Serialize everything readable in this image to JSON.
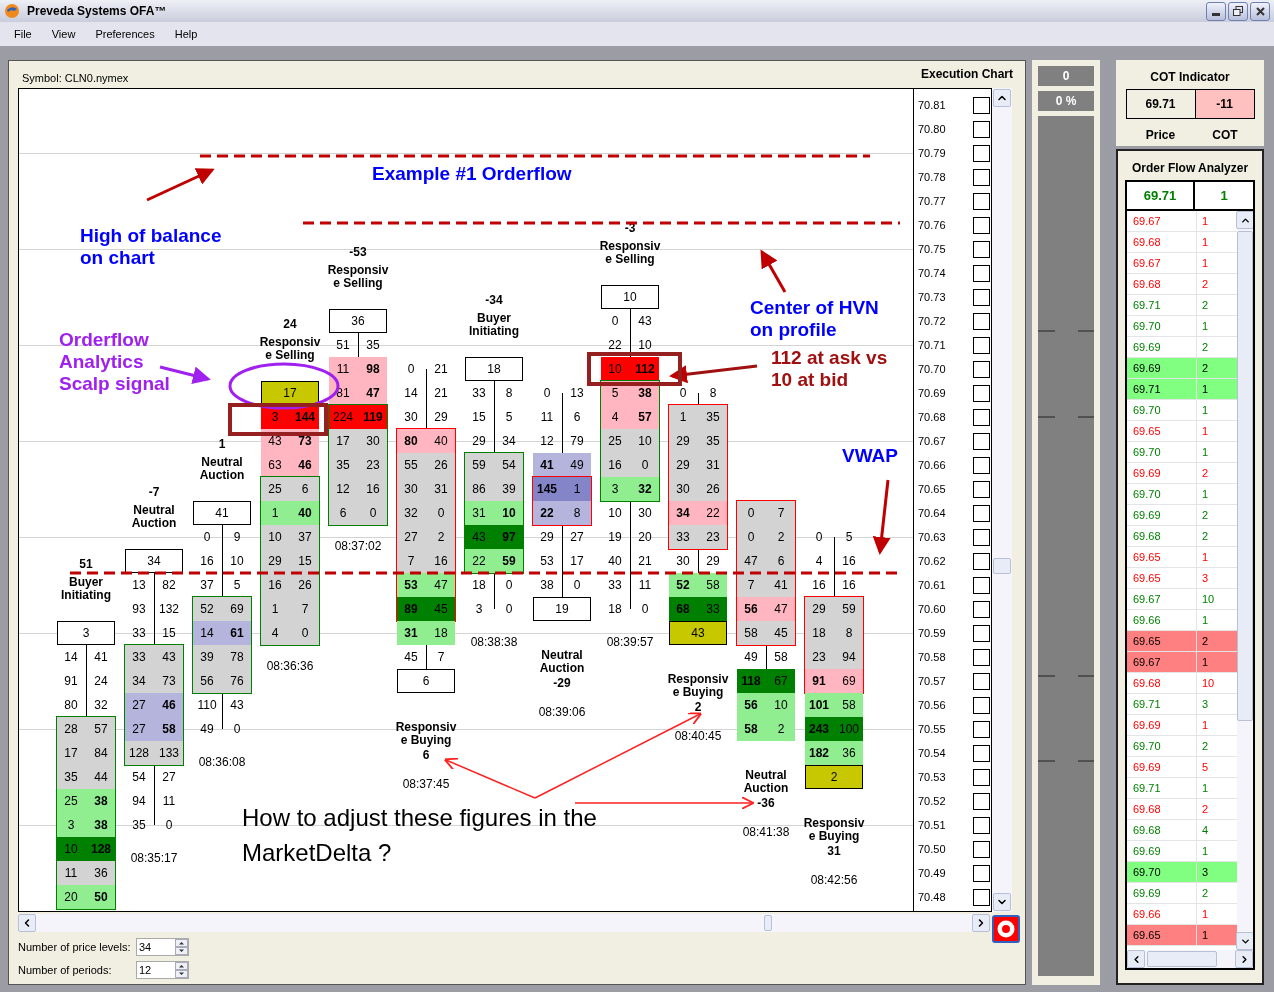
{
  "window": {
    "title": "Preveda Systems OFA™"
  },
  "menu": [
    "File",
    "View",
    "Preferences",
    "Help"
  ],
  "symbol": "Symbol: CLN0.nymex",
  "chart_title": "Execution Chart",
  "columns": [
    {
      "header": {
        "kind": "above",
        "delta": "51",
        "label": "Buyer\nInitiating"
      },
      "color": "#008000",
      "upper": [
        {
          "kind": "box",
          "value": "3"
        },
        {
          "kind": "pair",
          "bid": "14",
          "ask": "41",
          "bid_bold": false,
          "ask_bold": false
        },
        {
          "kind": "pair",
          "bid": "91",
          "ask": "24",
          "bid_bold": false,
          "ask_bold": false
        },
        {
          "kind": "pair",
          "bid": "80",
          "ask": "32",
          "bid_bold": false,
          "ask_bold": false
        }
      ],
      "body": [
        {
          "kind": "pair",
          "bid": "28",
          "ask": "57",
          "bid_bold": false,
          "ask_bold": false,
          "color": "#d3d3d3"
        },
        {
          "kind": "pair",
          "bid": "17",
          "ask": "84",
          "bid_bold": false,
          "ask_bold": false,
          "color": "#d3d3d3"
        },
        {
          "kind": "pair",
          "bid": "35",
          "ask": "44",
          "bid_bold": false,
          "ask_bold": false,
          "color": "#d3d3d3"
        },
        {
          "kind": "pair",
          "bid": "25",
          "ask": "38",
          "bid_bold": false,
          "ask_bold": true,
          "color": "#90ee90"
        },
        {
          "kind": "pair",
          "bid": "3",
          "ask": "38",
          "bid_bold": false,
          "ask_bold": true,
          "color": "#90ee90"
        },
        {
          "kind": "pair",
          "bid": "10",
          "ask": "128",
          "bid_bold": false,
          "ask_bold": true,
          "color": "#008000"
        },
        {
          "kind": "pair",
          "bid": "11",
          "ask": "36",
          "bid_bold": false,
          "ask_bold": false,
          "color": "#d3d3d3"
        },
        {
          "kind": "pair",
          "bid": "20",
          "ask": "50",
          "bid_bold": false,
          "ask_bold": true,
          "color": "#90ee90"
        }
      ]
    },
    {
      "header": {
        "kind": "above",
        "delta": "-7",
        "label": "Neutral\nAuction"
      },
      "time": "08:35:17",
      "color": "#008000",
      "upper": [
        {
          "kind": "box",
          "value": "34"
        },
        {
          "kind": "pair",
          "bid": "13",
          "ask": "82",
          "bid_bold": false,
          "ask_bold": false
        },
        {
          "kind": "pair",
          "bid": "93",
          "ask": "132",
          "bid_bold": false,
          "ask_bold": false
        },
        {
          "kind": "pair",
          "bid": "33",
          "ask": "15",
          "bid_bold": false,
          "ask_bold": false
        }
      ],
      "body": [
        {
          "kind": "pair",
          "bid": "33",
          "ask": "43",
          "bid_bold": false,
          "ask_bold": false,
          "color": "#d3d3d3"
        },
        {
          "kind": "pair",
          "bid": "34",
          "ask": "73",
          "bid_bold": false,
          "ask_bold": false,
          "color": "#d3d3d3"
        },
        {
          "kind": "pair",
          "bid": "27",
          "ask": "46",
          "bid_bold": false,
          "ask_bold": true,
          "color": "#b4b4dc"
        },
        {
          "kind": "pair",
          "bid": "27",
          "ask": "58",
          "bid_bold": false,
          "ask_bold": true,
          "color": "#b4b4dc"
        },
        {
          "kind": "pair",
          "bid": "128",
          "ask": "133",
          "bid_bold": false,
          "ask_bold": false,
          "color": "#d3d3d3"
        }
      ],
      "lower": [
        {
          "kind": "pair",
          "bid": "54",
          "ask": "27",
          "bid_bold": false,
          "ask_bold": false
        },
        {
          "kind": "pair",
          "bid": "94",
          "ask": "11",
          "bid_bold": false,
          "ask_bold": false
        },
        {
          "kind": "pair",
          "bid": "35",
          "ask": "0",
          "bid_bold": false,
          "ask_bold": false
        }
      ]
    },
    {
      "header": {
        "kind": "above",
        "delta": "1",
        "label": "Neutral\nAuction"
      },
      "time": "08:36:08",
      "color": "#008000",
      "upper": [
        {
          "kind": "box",
          "value": "41"
        },
        {
          "kind": "pair",
          "bid": "0",
          "ask": "9",
          "bid_bold": false,
          "ask_bold": false
        },
        {
          "kind": "pair",
          "bid": "16",
          "ask": "10",
          "bid_bold": false,
          "ask_bold": false
        },
        {
          "kind": "pair",
          "bid": "37",
          "ask": "5",
          "bid_bold": false,
          "ask_bold": false
        }
      ],
      "body": [
        {
          "kind": "pair",
          "bid": "52",
          "ask": "69",
          "bid_bold": false,
          "ask_bold": false,
          "color": "#d3d3d3"
        },
        {
          "kind": "pair",
          "bid": "14",
          "ask": "61",
          "bid_bold": false,
          "ask_bold": true,
          "color": "#b4b4dc"
        },
        {
          "kind": "pair",
          "bid": "39",
          "ask": "78",
          "bid_bold": false,
          "ask_bold": false,
          "color": "#d3d3d3"
        },
        {
          "kind": "pair",
          "bid": "56",
          "ask": "76",
          "bid_bold": false,
          "ask_bold": false,
          "color": "#d3d3d3"
        }
      ],
      "lower": [
        {
          "kind": "pair",
          "bid": "110",
          "ask": "43",
          "bid_bold": false,
          "ask_bold": false
        },
        {
          "kind": "pair",
          "bid": "49",
          "ask": "0",
          "bid_bold": false,
          "ask_bold": false
        }
      ]
    },
    {
      "header": {
        "kind": "above",
        "delta": "24",
        "label": "Responsiv\ne Selling"
      },
      "time": "08:36:36",
      "color": "#008000",
      "upper": [
        {
          "kind": "marker",
          "value": "17",
          "color": "#c8c800"
        },
        {
          "kind": "pair",
          "bid": "3",
          "ask": "144",
          "bid_bold": false,
          "ask_bold": true,
          "color": "#ff0000"
        },
        {
          "kind": "pair",
          "bid": "43",
          "ask": "73",
          "bid_bold": false,
          "ask_bold": true,
          "color": "#ffb6c1"
        },
        {
          "kind": "pair",
          "bid": "63",
          "ask": "46",
          "bid_bold": false,
          "ask_bold": true,
          "color": "#ffb6c1"
        }
      ],
      "body": [
        {
          "kind": "pair",
          "bid": "25",
          "ask": "6",
          "bid_bold": false,
          "ask_bold": false,
          "color": "#d3d3d3"
        },
        {
          "kind": "pair",
          "bid": "1",
          "ask": "40",
          "bid_bold": false,
          "ask_bold": true,
          "color": "#90ee90"
        },
        {
          "kind": "pair",
          "bid": "10",
          "ask": "37",
          "bid_bold": false,
          "ask_bold": false,
          "color": "#d3d3d3"
        },
        {
          "kind": "pair",
          "bid": "29",
          "ask": "15",
          "bid_bold": false,
          "ask_bold": false,
          "color": "#d3d3d3"
        },
        {
          "kind": "pair",
          "bid": "16",
          "ask": "26",
          "bid_bold": false,
          "ask_bold": false,
          "color": "#d3d3d3"
        },
        {
          "kind": "pair",
          "bid": "1",
          "ask": "7",
          "bid_bold": false,
          "ask_bold": false,
          "color": "#d3d3d3"
        },
        {
          "kind": "pair",
          "bid": "4",
          "ask": "0",
          "bid_bold": false,
          "ask_bold": false,
          "color": "#d3d3d3"
        }
      ]
    },
    {
      "header": {
        "kind": "above",
        "delta": "-53",
        "label": "Responsiv\ne Selling"
      },
      "time": "08:37:02",
      "color": "#008000",
      "upper": [
        {
          "kind": "box",
          "value": "36"
        },
        {
          "kind": "pair",
          "bid": "51",
          "ask": "35",
          "bid_bold": false,
          "ask_bold": false
        },
        {
          "kind": "pair",
          "bid": "11",
          "ask": "98",
          "bid_bold": false,
          "ask_bold": true,
          "color": "#ffb6c1"
        },
        {
          "kind": "pair",
          "bid": "81",
          "ask": "47",
          "bid_bold": false,
          "ask_bold": true,
          "color": "#ffb6c1"
        }
      ],
      "body": [
        {
          "kind": "pair",
          "bid": "224",
          "ask": "119",
          "bid_bold": false,
          "ask_bold": true,
          "color": "#ff0000"
        },
        {
          "kind": "pair",
          "bid": "17",
          "ask": "30",
          "bid_bold": false,
          "ask_bold": false,
          "color": "#d3d3d3"
        },
        {
          "kind": "pair",
          "bid": "35",
          "ask": "23",
          "bid_bold": false,
          "ask_bold": false,
          "color": "#d3d3d3"
        },
        {
          "kind": "pair",
          "bid": "12",
          "ask": "16",
          "bid_bold": false,
          "ask_bold": false,
          "color": "#d3d3d3"
        },
        {
          "kind": "pair",
          "bid": "6",
          "ask": "0",
          "bid_bold": false,
          "ask_bold": false,
          "color": "#d3d3d3"
        }
      ]
    },
    {
      "header": {
        "kind": "below",
        "delta": "6",
        "label": "Responsiv\ne Buying"
      },
      "time": "08:37:45",
      "color": "#ff0000",
      "upper": [
        {
          "kind": "pair",
          "bid": "0",
          "ask": "21",
          "bid_bold": false,
          "ask_bold": false
        },
        {
          "kind": "pair",
          "bid": "14",
          "ask": "21",
          "bid_bold": false,
          "ask_bold": false
        },
        {
          "kind": "pair",
          "bid": "30",
          "ask": "29",
          "bid_bold": false,
          "ask_bold": false
        }
      ],
      "body": [
        {
          "kind": "pair",
          "bid": "80",
          "ask": "40",
          "bid_bold": true,
          "ask_bold": false,
          "color": "#ffb6c1"
        },
        {
          "kind": "pair",
          "bid": "55",
          "ask": "26",
          "bid_bold": false,
          "ask_bold": false,
          "color": "#d3d3d3"
        },
        {
          "kind": "pair",
          "bid": "30",
          "ask": "31",
          "bid_bold": false,
          "ask_bold": false,
          "color": "#d3d3d3"
        },
        {
          "kind": "pair",
          "bid": "32",
          "ask": "0",
          "bid_bold": false,
          "ask_bold": false,
          "color": "#d3d3d3"
        },
        {
          "kind": "pair",
          "bid": "27",
          "ask": "2",
          "bid_bold": false,
          "ask_bold": false,
          "color": "#d3d3d3"
        },
        {
          "kind": "pair",
          "bid": "7",
          "ask": "16",
          "bid_bold": false,
          "ask_bold": false,
          "color": "#d3d3d3"
        },
        {
          "kind": "pair",
          "bid": "53",
          "ask": "47",
          "bid_bold": true,
          "ask_bold": false,
          "color": "#90ee90"
        },
        {
          "kind": "pair",
          "bid": "89",
          "ask": "45",
          "bid_bold": true,
          "ask_bold": false,
          "color": "#008000"
        }
      ],
      "lower": [
        {
          "kind": "pair",
          "bid": "31",
          "ask": "18",
          "bid_bold": true,
          "ask_bold": false,
          "color": "#90ee90"
        },
        {
          "kind": "pair",
          "bid": "45",
          "ask": "7",
          "bid_bold": false,
          "ask_bold": false
        },
        {
          "kind": "box",
          "value": "6"
        }
      ]
    },
    {
      "header": {
        "kind": "above",
        "delta": "-34",
        "label": "Buyer\nInitiating"
      },
      "time": "08:38:38",
      "color": "#008000",
      "upper": [
        {
          "kind": "box",
          "value": "18"
        },
        {
          "kind": "pair",
          "bid": "33",
          "ask": "8",
          "bid_bold": false,
          "ask_bold": false
        },
        {
          "kind": "pair",
          "bid": "15",
          "ask": "5",
          "bid_bold": false,
          "ask_bold": false
        },
        {
          "kind": "pair",
          "bid": "29",
          "ask": "34",
          "bid_bold": false,
          "ask_bold": false
        }
      ],
      "body": [
        {
          "kind": "pair",
          "bid": "59",
          "ask": "54",
          "bid_bold": false,
          "ask_bold": false,
          "color": "#d3d3d3"
        },
        {
          "kind": "pair",
          "bid": "86",
          "ask": "39",
          "bid_bold": false,
          "ask_bold": false,
          "color": "#d3d3d3"
        },
        {
          "kind": "pair",
          "bid": "31",
          "ask": "10",
          "bid_bold": false,
          "ask_bold": true,
          "color": "#90ee90"
        },
        {
          "kind": "pair",
          "bid": "43",
          "ask": "97",
          "bid_bold": false,
          "ask_bold": true,
          "color": "#008000"
        },
        {
          "kind": "pair",
          "bid": "22",
          "ask": "59",
          "bid_bold": false,
          "ask_bold": true,
          "color": "#90ee90"
        }
      ],
      "lower": [
        {
          "kind": "pair",
          "bid": "18",
          "ask": "0",
          "bid_bold": false,
          "ask_bold": false
        },
        {
          "kind": "pair",
          "bid": "3",
          "ask": "0",
          "bid_bold": false,
          "ask_bold": false
        }
      ]
    },
    {
      "header": {
        "kind": "below",
        "delta": "-29",
        "label": "Neutral\nAuction"
      },
      "time": "08:39:06",
      "color": "#ff0000",
      "upper": [
        {
          "kind": "pair",
          "bid": "0",
          "ask": "13",
          "bid_bold": false,
          "ask_bold": false
        },
        {
          "kind": "pair",
          "bid": "11",
          "ask": "6",
          "bid_bold": false,
          "ask_bold": false
        },
        {
          "kind": "pair",
          "bid": "12",
          "ask": "79",
          "bid_bold": false,
          "ask_bold": false
        },
        {
          "kind": "pair",
          "bid": "41",
          "ask": "49",
          "bid_bold": true,
          "ask_bold": false,
          "color": "#b4b4dc"
        }
      ],
      "body": [
        {
          "kind": "pair",
          "bid": "145",
          "ask": "1",
          "bid_bold": true,
          "ask_bold": false,
          "color": "#8484c8"
        },
        {
          "kind": "pair",
          "bid": "22",
          "ask": "8",
          "bid_bold": true,
          "ask_bold": false,
          "color": "#b4b4dc"
        }
      ],
      "lower": [
        {
          "kind": "pair",
          "bid": "29",
          "ask": "27",
          "bid_bold": false,
          "ask_bold": false
        },
        {
          "kind": "pair",
          "bid": "53",
          "ask": "17",
          "bid_bold": false,
          "ask_bold": false
        },
        {
          "kind": "pair",
          "bid": "38",
          "ask": "0",
          "bid_bold": false,
          "ask_bold": false
        },
        {
          "kind": "box",
          "value": "19"
        }
      ]
    },
    {
      "header": {
        "kind": "above",
        "delta": "-3",
        "label": "Responsiv\ne Selling"
      },
      "time": "08:39:57",
      "color": "#008000",
      "upper": [
        {
          "kind": "box",
          "value": "10"
        },
        {
          "kind": "pair",
          "bid": "0",
          "ask": "43",
          "bid_bold": false,
          "ask_bold": false
        },
        {
          "kind": "pair",
          "bid": "22",
          "ask": "10",
          "bid_bold": false,
          "ask_bold": false
        },
        {
          "kind": "pair",
          "bid": "10",
          "ask": "112",
          "bid_bold": false,
          "ask_bold": true,
          "color": "#ff0000"
        }
      ],
      "body": [
        {
          "kind": "pair",
          "bid": "5",
          "ask": "38",
          "bid_bold": false,
          "ask_bold": true,
          "color": "#ffb6c1"
        },
        {
          "kind": "pair",
          "bid": "4",
          "ask": "57",
          "bid_bold": false,
          "ask_bold": true,
          "color": "#ffb6c1"
        },
        {
          "kind": "pair",
          "bid": "25",
          "ask": "10",
          "bid_bold": false,
          "ask_bold": false,
          "color": "#d3d3d3"
        },
        {
          "kind": "pair",
          "bid": "16",
          "ask": "0",
          "bid_bold": false,
          "ask_bold": false,
          "color": "#d3d3d3"
        },
        {
          "kind": "pair",
          "bid": "3",
          "ask": "32",
          "bid_bold": false,
          "ask_bold": true,
          "color": "#90ee90"
        }
      ],
      "lower": [
        {
          "kind": "pair",
          "bid": "10",
          "ask": "30",
          "bid_bold": false,
          "ask_bold": false
        },
        {
          "kind": "pair",
          "bid": "19",
          "ask": "20",
          "bid_bold": false,
          "ask_bold": false
        },
        {
          "kind": "pair",
          "bid": "40",
          "ask": "21",
          "bid_bold": false,
          "ask_bold": false
        },
        {
          "kind": "pair",
          "bid": "33",
          "ask": "11",
          "bid_bold": false,
          "ask_bold": false
        },
        {
          "kind": "pair",
          "bid": "18",
          "ask": "0",
          "bid_bold": false,
          "ask_bold": false
        }
      ]
    },
    {
      "header": {
        "kind": "below",
        "delta": "2",
        "label": "Responsiv\ne Buying"
      },
      "time": "08:40:45",
      "color": "#ff0000",
      "upper": [
        {
          "kind": "pair",
          "bid": "0",
          "ask": "8",
          "bid_bold": false,
          "ask_bold": false
        }
      ],
      "body": [
        {
          "kind": "pair",
          "bid": "1",
          "ask": "35",
          "bid_bold": false,
          "ask_bold": false,
          "color": "#d3d3d3"
        },
        {
          "kind": "pair",
          "bid": "29",
          "ask": "35",
          "bid_bold": false,
          "ask_bold": false,
          "color": "#d3d3d3"
        },
        {
          "kind": "pair",
          "bid": "29",
          "ask": "31",
          "bid_bold": false,
          "ask_bold": false,
          "color": "#d3d3d3"
        },
        {
          "kind": "pair",
          "bid": "30",
          "ask": "26",
          "bid_bold": false,
          "ask_bold": false,
          "color": "#d3d3d3"
        },
        {
          "kind": "pair",
          "bid": "34",
          "ask": "22",
          "bid_bold": true,
          "ask_bold": false,
          "color": "#ffb6c1"
        },
        {
          "kind": "pair",
          "bid": "33",
          "ask": "23",
          "bid_bold": false,
          "ask_bold": false,
          "color": "#d3d3d3"
        }
      ],
      "lower": [
        {
          "kind": "pair",
          "bid": "30",
          "ask": "29",
          "bid_bold": false,
          "ask_bold": false
        },
        {
          "kind": "pair",
          "bid": "52",
          "ask": "58",
          "bid_bold": true,
          "ask_bold": false,
          "color": "#90ee90"
        },
        {
          "kind": "pair",
          "bid": "68",
          "ask": "33",
          "bid_bold": true,
          "ask_bold": false,
          "color": "#008000"
        },
        {
          "kind": "marker",
          "value": "43",
          "color": "#c8c800"
        }
      ]
    },
    {
      "header": {
        "kind": "below",
        "delta": "-36",
        "label": "Neutral\nAuction"
      },
      "time": "08:41:38",
      "color": "#ff0000",
      "body": [
        {
          "kind": "pair",
          "bid": "0",
          "ask": "7",
          "bid_bold": false,
          "ask_bold": false,
          "color": "#d3d3d3"
        },
        {
          "kind": "pair",
          "bid": "0",
          "ask": "2",
          "bid_bold": false,
          "ask_bold": false,
          "color": "#d3d3d3"
        },
        {
          "kind": "pair",
          "bid": "47",
          "ask": "6",
          "bid_bold": false,
          "ask_bold": false,
          "color": "#d3d3d3"
        },
        {
          "kind": "pair",
          "bid": "7",
          "ask": "41",
          "bid_bold": false,
          "ask_bold": false,
          "color": "#d3d3d3"
        },
        {
          "kind": "pair",
          "bid": "56",
          "ask": "47",
          "bid_bold": true,
          "ask_bold": false,
          "color": "#ffb6c1"
        },
        {
          "kind": "pair",
          "bid": "58",
          "ask": "45",
          "bid_bold": false,
          "ask_bold": false,
          "color": "#d3d3d3"
        }
      ],
      "lower": [
        {
          "kind": "pair",
          "bid": "49",
          "ask": "58",
          "bid_bold": false,
          "ask_bold": false
        },
        {
          "kind": "pair",
          "bid": "118",
          "ask": "67",
          "bid_bold": true,
          "ask_bold": false,
          "color": "#008000"
        },
        {
          "kind": "pair",
          "bid": "56",
          "ask": "10",
          "bid_bold": true,
          "ask_bold": false,
          "color": "#90ee90"
        },
        {
          "kind": "pair",
          "bid": "58",
          "ask": "2",
          "bid_bold": true,
          "ask_bold": false,
          "color": "#90ee90"
        }
      ]
    },
    {
      "header": {
        "kind": "below",
        "delta": "31",
        "label": "Responsiv\ne Buying"
      },
      "time": "08:42:56",
      "color": "#ff0000",
      "upper": [
        {
          "kind": "pair",
          "bid": "0",
          "ask": "5",
          "bid_bold": false,
          "ask_bold": false
        },
        {
          "kind": "pair",
          "bid": "4",
          "ask": "16",
          "bid_bold": false,
          "ask_bold": false
        },
        {
          "kind": "pair",
          "bid": "16",
          "ask": "16",
          "bid_bold": false,
          "ask_bold": false
        }
      ],
      "body": [
        {
          "kind": "pair",
          "bid": "29",
          "ask": "59",
          "bid_bold": false,
          "ask_bold": false,
          "color": "#d3d3d3"
        },
        {
          "kind": "pair",
          "bid": "18",
          "ask": "8",
          "bid_bold": false,
          "ask_bold": false,
          "color": "#d3d3d3"
        },
        {
          "kind": "pair",
          "bid": "23",
          "ask": "94",
          "bid_bold": false,
          "ask_bold": false,
          "color": "#d3d3d3"
        },
        {
          "kind": "pair",
          "bid": "91",
          "ask": "69",
          "bid_bold": true,
          "ask_bold": false,
          "color": "#ffb6c1"
        }
      ],
      "lower": [
        {
          "kind": "pair",
          "bid": "101",
          "ask": "58",
          "bid_bold": true,
          "ask_bold": false,
          "color": "#90ee90"
        },
        {
          "kind": "pair",
          "bid": "243",
          "ask": "100",
          "bid_bold": true,
          "ask_bold": false,
          "color": "#008000"
        },
        {
          "kind": "pair",
          "bid": "182",
          "ask": "36",
          "bid_bold": true,
          "ask_bold": false,
          "color": "#90ee90"
        },
        {
          "kind": "marker",
          "value": "2",
          "color": "#c8c800"
        }
      ]
    }
  ],
  "price_axis": [
    {
      "price": "70.81",
      "checked": false
    },
    {
      "price": "70.80",
      "checked": false
    },
    {
      "price": "70.79",
      "checked": false
    },
    {
      "price": "70.78",
      "checked": false
    },
    {
      "price": "70.77",
      "checked": false
    },
    {
      "price": "70.76",
      "checked": false
    },
    {
      "price": "70.75",
      "checked": false
    },
    {
      "price": "70.74",
      "checked": false
    },
    {
      "price": "70.73",
      "checked": false
    },
    {
      "price": "70.72",
      "checked": false
    },
    {
      "price": "70.71",
      "checked": false
    },
    {
      "price": "70.70",
      "checked": false
    },
    {
      "price": "70.69",
      "checked": false
    },
    {
      "price": "70.68",
      "checked": false
    },
    {
      "price": "70.67",
      "checked": false
    },
    {
      "price": "70.66",
      "checked": false
    },
    {
      "price": "70.65",
      "checked": false
    },
    {
      "price": "70.64",
      "checked": false
    },
    {
      "price": "70.63",
      "checked": false
    },
    {
      "price": "70.62",
      "checked": false
    },
    {
      "price": "70.61",
      "checked": false
    },
    {
      "price": "70.60",
      "checked": false
    },
    {
      "price": "70.59",
      "checked": false
    },
    {
      "price": "70.58",
      "checked": false
    },
    {
      "price": "70.57",
      "checked": false
    },
    {
      "price": "70.56",
      "checked": false
    },
    {
      "price": "70.55",
      "checked": false
    },
    {
      "price": "70.54",
      "checked": false
    },
    {
      "price": "70.53",
      "checked": false
    },
    {
      "price": "70.52",
      "checked": false
    },
    {
      "price": "70.51",
      "checked": false
    },
    {
      "price": "70.50",
      "checked": false
    },
    {
      "price": "70.49",
      "checked": false
    },
    {
      "price": "70.48",
      "checked": false
    }
  ],
  "annotations": [
    {
      "kind": "callout",
      "text": "Example #1 Orderflow",
      "color": "#0000ff"
    },
    {
      "kind": "callout",
      "text": "High of balance\non chart",
      "color": "#0000ff"
    },
    {
      "kind": "callout",
      "text": "Orderflow\nAnalytics\nScalp signal",
      "color": "#a020f0"
    },
    {
      "kind": "callout",
      "text": "Center of HVN\non profile",
      "color": "#0000ff"
    },
    {
      "kind": "callout",
      "text": "112 at ask vs\n10 at bid",
      "color": "#a01010"
    },
    {
      "kind": "callout",
      "text": "VWAP",
      "color": "#0000ff"
    },
    {
      "kind": "question",
      "text": "How to adjust these figures in the\nMarketDelta ?",
      "color": "#000000"
    }
  ],
  "settings": [
    {
      "label": "Number of price levels:",
      "value": "34"
    },
    {
      "label": "Number of periods:",
      "value": "12"
    }
  ],
  "gauge": {
    "count": "0",
    "percent": "0 %"
  },
  "cot": {
    "title": "COT Indicator",
    "price": "69.71",
    "value": "-11",
    "price_label": "Price",
    "value_label": "COT"
  },
  "order_flow": {
    "title": "Order Flow Analyzer",
    "price": "69.71",
    "quantity": "1",
    "rows": [
      {
        "price": "69.67",
        "quantity": "1",
        "kind": "sell",
        "highlighted": false
      },
      {
        "price": "69.68",
        "quantity": "1",
        "kind": "sell",
        "highlighted": false
      },
      {
        "price": "69.67",
        "quantity": "1",
        "kind": "sell",
        "highlighted": false
      },
      {
        "price": "69.68",
        "quantity": "2",
        "kind": "sell",
        "highlighted": false
      },
      {
        "price": "69.71",
        "quantity": "2",
        "kind": "buy",
        "highlighted": false
      },
      {
        "price": "69.70",
        "quantity": "1",
        "kind": "buy",
        "highlighted": false
      },
      {
        "price": "69.69",
        "quantity": "2",
        "kind": "buy",
        "highlighted": false
      },
      {
        "price": "69.69",
        "quantity": "2",
        "kind": "buy",
        "highlighted": true
      },
      {
        "price": "69.71",
        "quantity": "1",
        "kind": "buy",
        "highlighted": true
      },
      {
        "price": "69.70",
        "quantity": "1",
        "kind": "buy",
        "highlighted": false
      },
      {
        "price": "69.65",
        "quantity": "1",
        "kind": "sell",
        "highlighted": false
      },
      {
        "price": "69.70",
        "quantity": "1",
        "kind": "buy",
        "highlighted": false
      },
      {
        "price": "69.69",
        "quantity": "2",
        "kind": "sell",
        "highlighted": false
      },
      {
        "price": "69.70",
        "quantity": "1",
        "kind": "buy",
        "highlighted": false
      },
      {
        "price": "69.69",
        "quantity": "2",
        "kind": "buy",
        "highlighted": false
      },
      {
        "price": "69.68",
        "quantity": "2",
        "kind": "buy",
        "highlighted": false
      },
      {
        "price": "69.65",
        "quantity": "1",
        "kind": "sell",
        "highlighted": false
      },
      {
        "price": "69.65",
        "quantity": "3",
        "kind": "sell",
        "highlighted": false
      },
      {
        "price": "69.67",
        "quantity": "10",
        "kind": "buy",
        "highlighted": false
      },
      {
        "price": "69.66",
        "quantity": "1",
        "kind": "buy",
        "highlighted": false
      },
      {
        "price": "69.65",
        "quantity": "2",
        "kind": "sell",
        "highlighted": true
      },
      {
        "price": "69.67",
        "quantity": "1",
        "kind": "sell",
        "highlighted": true
      },
      {
        "price": "69.68",
        "quantity": "10",
        "kind": "sell",
        "highlighted": false
      },
      {
        "price": "69.71",
        "quantity": "3",
        "kind": "buy",
        "highlighted": false
      },
      {
        "price": "69.69",
        "quantity": "1",
        "kind": "sell",
        "highlighted": false
      },
      {
        "price": "69.70",
        "quantity": "2",
        "kind": "buy",
        "highlighted": false
      },
      {
        "price": "69.69",
        "quantity": "5",
        "kind": "sell",
        "highlighted": false
      },
      {
        "price": "69.71",
        "quantity": "1",
        "kind": "buy",
        "highlighted": false
      },
      {
        "price": "69.68",
        "quantity": "2",
        "kind": "sell",
        "highlighted": false
      },
      {
        "price": "69.68",
        "quantity": "4",
        "kind": "buy",
        "highlighted": false
      },
      {
        "price": "69.69",
        "quantity": "1",
        "kind": "buy",
        "highlighted": false
      },
      {
        "price": "69.70",
        "quantity": "3",
        "kind": "buy",
        "highlighted": true
      },
      {
        "price": "69.69",
        "quantity": "2",
        "kind": "buy",
        "highlighted": false
      },
      {
        "price": "69.66",
        "quantity": "1",
        "kind": "sell",
        "highlighted": false
      },
      {
        "price": "69.65",
        "quantity": "1",
        "kind": "sell",
        "highlighted": true
      }
    ]
  }
}
